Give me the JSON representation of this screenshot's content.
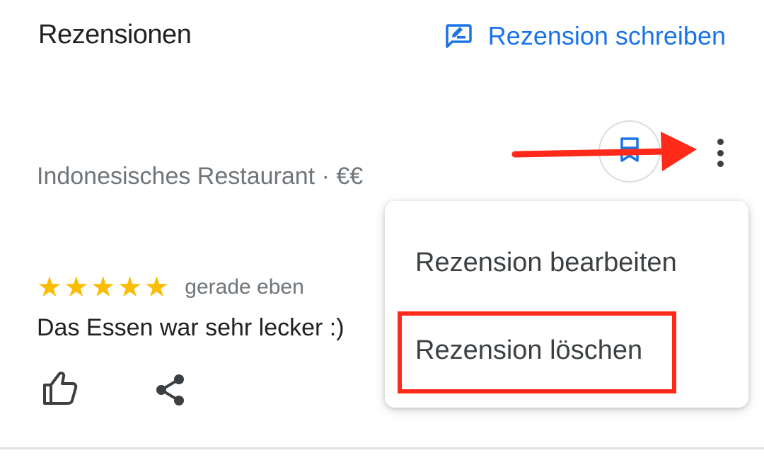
{
  "header": {
    "title": "Rezensionen",
    "write_review_label": "Rezension schreiben"
  },
  "place": {
    "subtitle": "Indonesisches Restaurant · €€"
  },
  "review": {
    "stars": 5,
    "time": "gerade eben",
    "text": "Das Essen war sehr lecker :)"
  },
  "menu": {
    "edit_label": "Rezension bearbeiten",
    "delete_label": "Rezension löschen"
  },
  "icons": {
    "write": "edit-review-icon",
    "bookmark": "bookmark-icon",
    "more": "more-vert-icon",
    "like": "thumb-up-icon",
    "share": "share-icon",
    "annotation_arrow": "arrow-right-icon"
  },
  "colors": {
    "accent": "#1a73e8",
    "star": "#fbbc04",
    "highlight": "#ff2a1a"
  }
}
